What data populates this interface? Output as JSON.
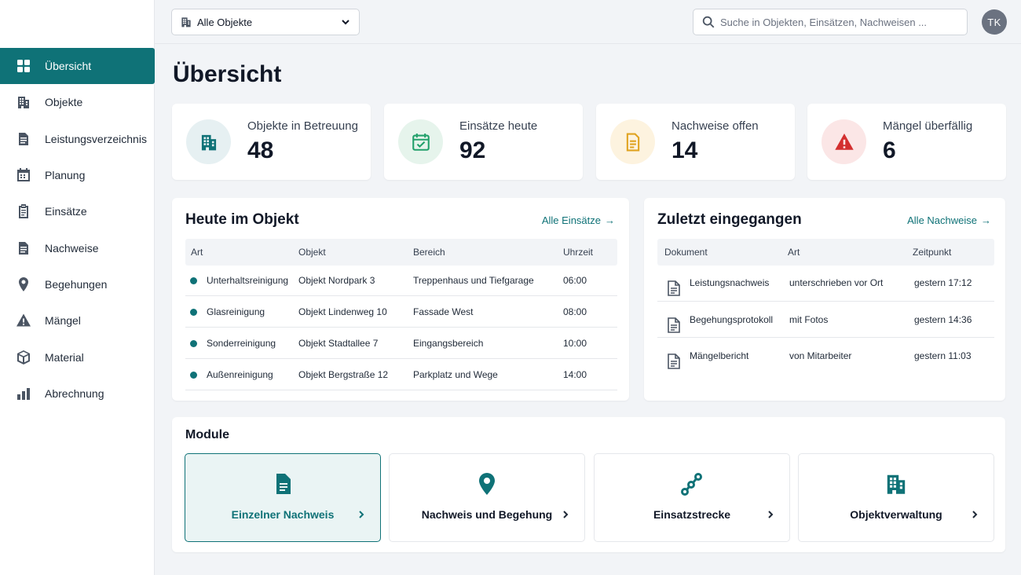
{
  "sidebar": {
    "items": [
      {
        "label": "Übersicht",
        "icon": "dashboard-grid-icon"
      },
      {
        "label": "Objekte",
        "icon": "building-icon"
      },
      {
        "label": "Leistungsverzeichnis",
        "icon": "document-icon"
      },
      {
        "label": "Planung",
        "icon": "calendar-icon"
      },
      {
        "label": "Einsätze",
        "icon": "clipboard-icon"
      },
      {
        "label": "Nachweise",
        "icon": "document-icon"
      },
      {
        "label": "Begehungen",
        "icon": "location-pin-icon"
      },
      {
        "label": "Mängel",
        "icon": "warning-icon"
      },
      {
        "label": "Material",
        "icon": "box-icon"
      },
      {
        "label": "Abrechnung",
        "icon": "bar-chart-icon"
      }
    ]
  },
  "topbar": {
    "object_select": "Alle Objekte",
    "search_placeholder": "Suche in Objekten, Einsätzen, Nachweisen ...",
    "avatar_initials": "TK"
  },
  "page_title": "Übersicht",
  "stats": [
    {
      "label": "Objekte in Betreuung",
      "value": "48",
      "icon": "building-icon",
      "color": "#0f7277",
      "bg": "#e6f0f2"
    },
    {
      "label": "Einsätze heute",
      "value": "92",
      "icon": "calendar-icon",
      "color": "#22a06b",
      "bg": "#e6f4ec"
    },
    {
      "label": "Nachweise offen",
      "value": "14",
      "icon": "document-icon",
      "color": "#e0a320",
      "bg": "#fdf3df"
    },
    {
      "label": "Mängel überfällig",
      "value": "6",
      "icon": "warning-icon",
      "color": "#d32f2f",
      "bg": "#fbe6e6"
    }
  ],
  "today": {
    "title": "Heute im Objekt",
    "link": "Alle Einsätze",
    "columns": [
      "Art",
      "Objekt",
      "Bereich",
      "Uhrzeit"
    ],
    "rows": [
      {
        "art": "Unterhaltsreinigung",
        "objekt": "Objekt Nordpark 3",
        "bereich": "Treppenhaus und Tiefgarage",
        "uhrzeit": "06:00"
      },
      {
        "art": "Glasreinigung",
        "objekt": "Objekt Lindenweg 10",
        "bereich": "Fassade West",
        "uhrzeit": "08:00"
      },
      {
        "art": "Sonderreinigung",
        "objekt": "Objekt Stadtallee 7",
        "bereich": "Eingangsbereich",
        "uhrzeit": "10:00"
      },
      {
        "art": "Außenreinigung",
        "objekt": "Objekt Bergstraße 12",
        "bereich": "Parkplatz und Wege",
        "uhrzeit": "14:00"
      }
    ]
  },
  "recent": {
    "title": "Zuletzt eingegangen",
    "link": "Alle Nachweise",
    "columns": [
      "Dokument",
      "Art",
      "Zeitpunkt"
    ],
    "rows": [
      {
        "dokument": "Leistungsnachweis",
        "art": "unterschrieben vor Ort",
        "zeitpunkt": "gestern 17:12"
      },
      {
        "dokument": "Begehungsprotokoll",
        "art": "mit Fotos",
        "zeitpunkt": "gestern 14:36"
      },
      {
        "dokument": "Mängelbericht",
        "art": "von Mitarbeiter",
        "zeitpunkt": "gestern 11:03"
      }
    ]
  },
  "modules": {
    "title": "Module",
    "items": [
      {
        "label": "Einzelner Nachweis",
        "icon": "document-icon"
      },
      {
        "label": "Nachweis und Begehung",
        "icon": "location-pin-icon"
      },
      {
        "label": "Einsatzstrecke",
        "icon": "route-icon"
      },
      {
        "label": "Objektverwaltung",
        "icon": "building-icon"
      }
    ]
  }
}
